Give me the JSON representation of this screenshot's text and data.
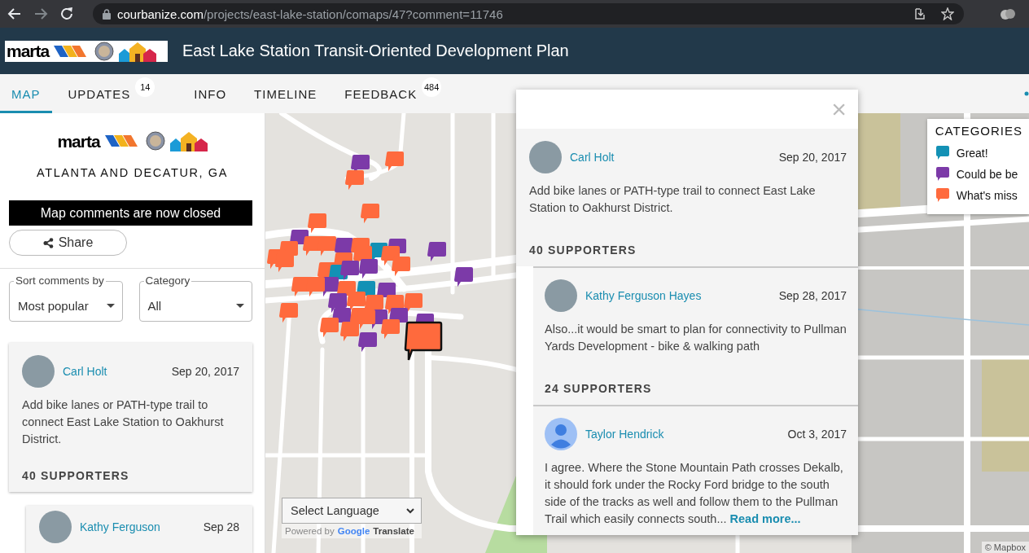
{
  "browser": {
    "url_host": "courbanize.com",
    "url_path": "/projects/east-lake-station/comaps/47?comment=11746"
  },
  "header": {
    "logo_text": "marta",
    "title": "East Lake Station Transit-Oriented Development Plan"
  },
  "tabs": [
    {
      "label": "MAP",
      "selected": true
    },
    {
      "label": "UPDATES",
      "badge": "14",
      "selected": false
    },
    {
      "label": "INFO",
      "selected": false
    },
    {
      "label": "TIMELINE",
      "selected": false
    },
    {
      "label": "FEEDBACK",
      "badge": "484",
      "selected": false
    }
  ],
  "sidebar": {
    "logo_text": "marta",
    "location": "ATLANTA AND DECATUR, GA",
    "notice": "Map comments are now closed",
    "share_button": "Share",
    "filters": [
      {
        "label": "Sort comments by",
        "value": "Most popular"
      },
      {
        "label": "Category",
        "value": "All"
      }
    ],
    "comments": [
      {
        "kind": "comment",
        "avatar": {
          "kind": "photo"
        },
        "author": "Carl Holt",
        "date": "Sep 20, 2017",
        "text": "Add bike lanes or PATH-type trail to connect East Lake Station to Oakhurst District.",
        "supporters": "40 SUPPORTERS"
      },
      {
        "kind": "reply",
        "avatar": {
          "kind": "photo"
        },
        "author": "Kathy Ferguson",
        "date": "Sep 28"
      }
    ]
  },
  "map": {
    "translate": {
      "select": "Select Language",
      "powered_by": "Powered by",
      "google": "Google",
      "translate": "Translate"
    },
    "attribution": "© Mapbox"
  },
  "categories": {
    "title": "CATEGORIES",
    "items": [
      {
        "label": "Great!",
        "color": "#1391b5"
      },
      {
        "label": "Could be be",
        "color": "#7c3aa8"
      },
      {
        "label": "What's miss",
        "color": "#ff6a3d"
      }
    ]
  },
  "popup": {
    "close": "×",
    "comments": [
      {
        "kind": "comment",
        "avatar": {
          "kind": "photo"
        },
        "author": "Carl Holt",
        "date": "Sep 20, 2017",
        "text": "Add bike lanes or PATH-type trail to connect East Lake Station to Oakhurst District.",
        "supporters": "40 SUPPORTERS"
      },
      {
        "kind": "reply",
        "avatar": {
          "kind": "photo"
        },
        "author": "Kathy Ferguson Hayes",
        "date": "Sep 28, 2017",
        "text": "Also...it would be smart to plan for connectivity to Pullman Yards Development - bike & walking path",
        "supporters": "24 SUPPORTERS"
      },
      {
        "kind": "reply",
        "avatar": {
          "kind": "default"
        },
        "author": "Taylor Hendrick",
        "date": "Oct 3, 2017",
        "text": "I agree. Where the Stone Mountain Path crosses Dekalb, it should fork under the Rocky Ford bridge to the south side of the tracks as well and follow them to the Pullman Trail which easily connects south...",
        "link": "Read more..."
      }
    ]
  }
}
